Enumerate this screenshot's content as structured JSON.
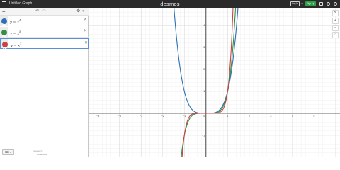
{
  "header": {
    "document_title": "Untitled Graph",
    "brand": "desmos",
    "login_label": "Log In",
    "or_label": "or",
    "signup_label": "Sign Up"
  },
  "toolbar": {
    "add_label": "+",
    "undo_glyph": "↶",
    "redo_glyph": "↷",
    "settings_glyph": "⚙",
    "collapse_glyph": "«"
  },
  "expressions": [
    {
      "latex_base": "y = x",
      "exponent": "4",
      "color": "#2d70b3",
      "icon": "wave-icon"
    },
    {
      "latex_base": "y = x",
      "exponent": "5",
      "color": "#388c46",
      "icon": "wave-icon"
    },
    {
      "latex_base": "y = x",
      "exponent": "7",
      "color": "#c74440",
      "icon": "wave-icon"
    }
  ],
  "footer": {
    "keyboard_label": "⌨ ▾",
    "powered_by": "powered by",
    "powered_logo": "desmos"
  },
  "graph": {
    "x_tick_labels": [
      "−5",
      "−4",
      "−3",
      "−2",
      "−1",
      "0",
      "1",
      "2",
      "3",
      "4",
      "5"
    ],
    "y_tick_labels": [
      "4",
      "3",
      "2",
      "1",
      "−1",
      "−2"
    ],
    "xlim": [
      -5.4,
      6.2
    ],
    "ylim": [
      -2.0,
      4.8
    ]
  },
  "right_tools": [
    "✎",
    "+",
    "−",
    "⌂"
  ],
  "chart_data": {
    "type": "line",
    "title": "",
    "xlabel": "",
    "ylabel": "",
    "xlim": [
      -5.4,
      6.2
    ],
    "ylim": [
      -2.0,
      4.8
    ],
    "grid": true,
    "series": [
      {
        "name": "y = x^4",
        "color": "#2d70b3",
        "exponent": 4
      },
      {
        "name": "y = x^5",
        "color": "#388c46",
        "exponent": 5
      },
      {
        "name": "y = x^7",
        "color": "#c74440",
        "exponent": 7
      }
    ]
  }
}
